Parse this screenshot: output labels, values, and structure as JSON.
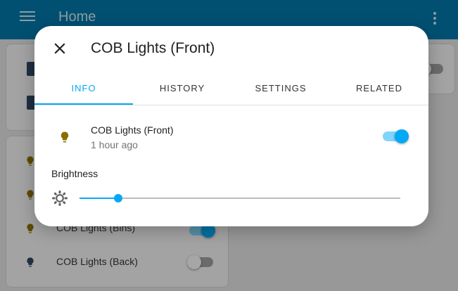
{
  "colors": {
    "header": "#0277a8",
    "accent": "#03a9f4",
    "bulb_on": "#8a6d00",
    "bulb_off": "#2f4660"
  },
  "app": {
    "title": "Home",
    "menu_icon": "hamburger-menu-icon",
    "overflow_icon": "more-vertical-icon"
  },
  "background": {
    "rows": [
      {
        "label": "COB Lights (Bins)",
        "state": "on"
      },
      {
        "label": "COB Lights (Back)",
        "state": "off"
      }
    ]
  },
  "dialog": {
    "title": "COB Lights (Front)",
    "close_icon": "close-icon",
    "tabs": [
      {
        "label": "INFO",
        "active": true
      },
      {
        "label": "HISTORY",
        "active": false
      },
      {
        "label": "SETTINGS",
        "active": false
      },
      {
        "label": "RELATED",
        "active": false
      }
    ],
    "entity": {
      "icon": "lightbulb-icon",
      "name": "COB Lights (Front)",
      "last_changed": "1 hour ago",
      "state": "on"
    },
    "brightness": {
      "label": "Brightness",
      "icon": "brightness-icon",
      "value_fraction": 0.12
    }
  }
}
